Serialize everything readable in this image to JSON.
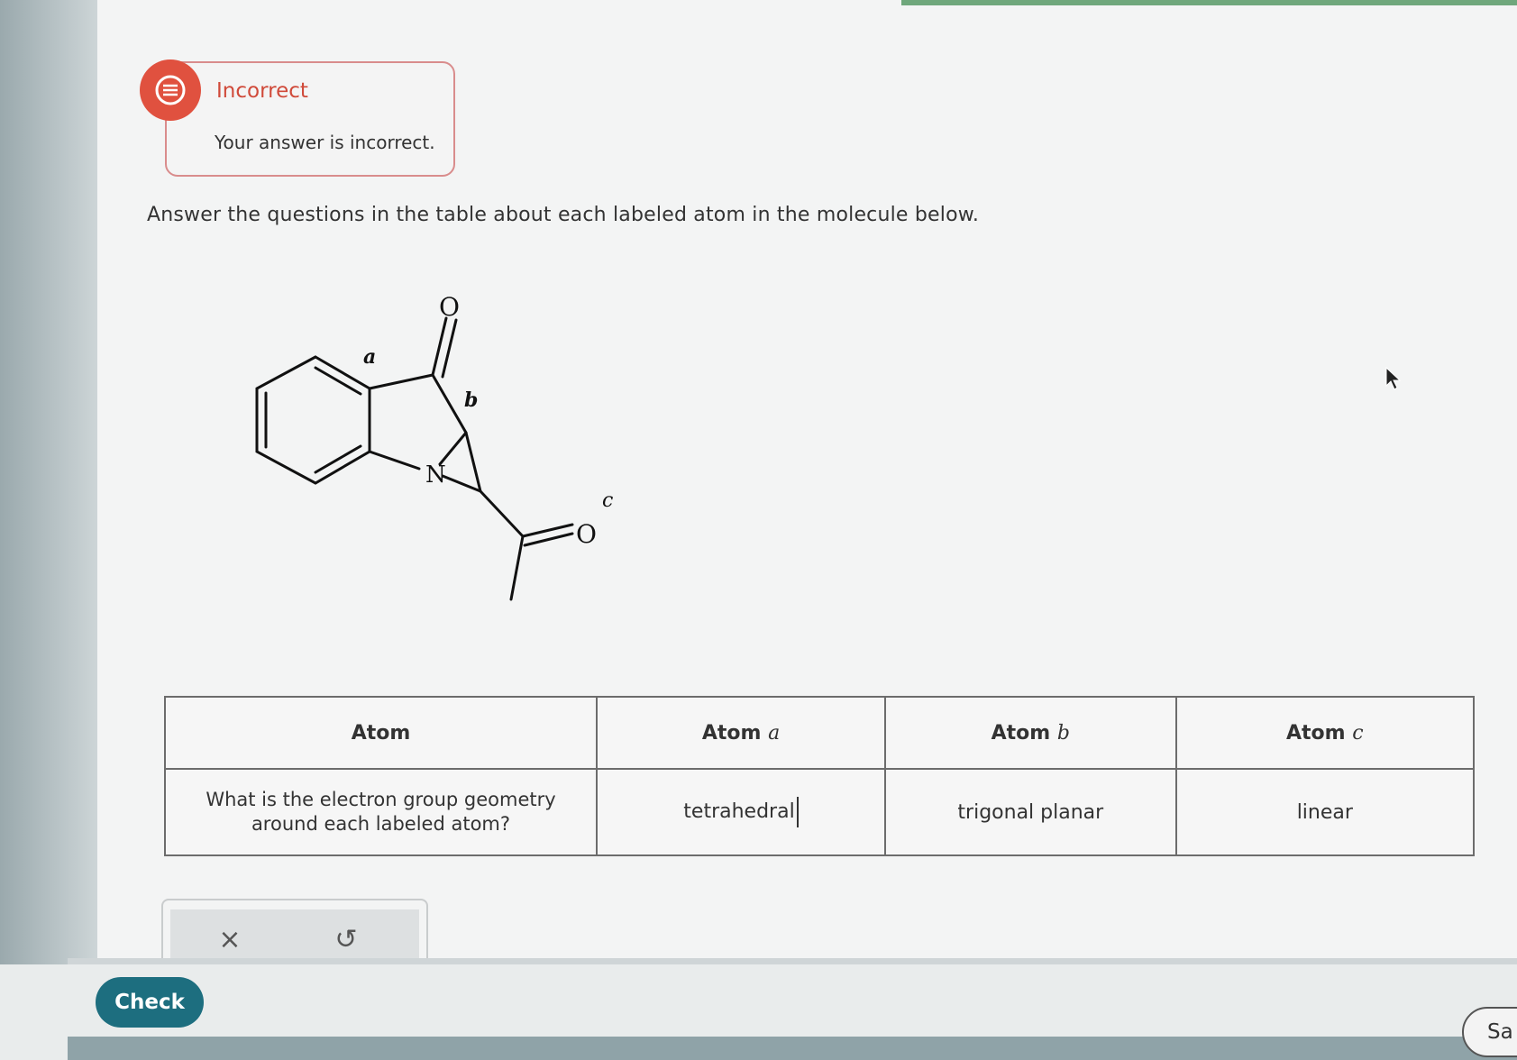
{
  "feedback": {
    "title": "Incorrect",
    "message": "Your answer is incorrect.",
    "status_color": "#e0513f"
  },
  "question": {
    "prompt": "Answer the questions in the table about each labeled atom in the molecule below."
  },
  "molecule": {
    "labels": {
      "a": "a",
      "b": "b",
      "c": "c",
      "oxygen_top": "O",
      "oxygen_right": "O",
      "nitrogen": "N"
    }
  },
  "table": {
    "header": {
      "atom": "Atom",
      "atom_prefix": "Atom",
      "a": "a",
      "b": "b",
      "c": "c"
    },
    "row": {
      "question": "What is the electron group geometry around each labeled atom?",
      "answer_a": "tetrahedral",
      "answer_b": "trigonal planar",
      "answer_c": "linear"
    }
  },
  "actions": {
    "clear_icon": "close-icon",
    "clear_symbol": "×",
    "undo_icon": "undo-icon",
    "undo_symbol": "↺"
  },
  "footer": {
    "check_label": "Check",
    "save_label": "Sa"
  },
  "colors": {
    "accent": "#1d6e7f",
    "error": "#d04a3a"
  }
}
